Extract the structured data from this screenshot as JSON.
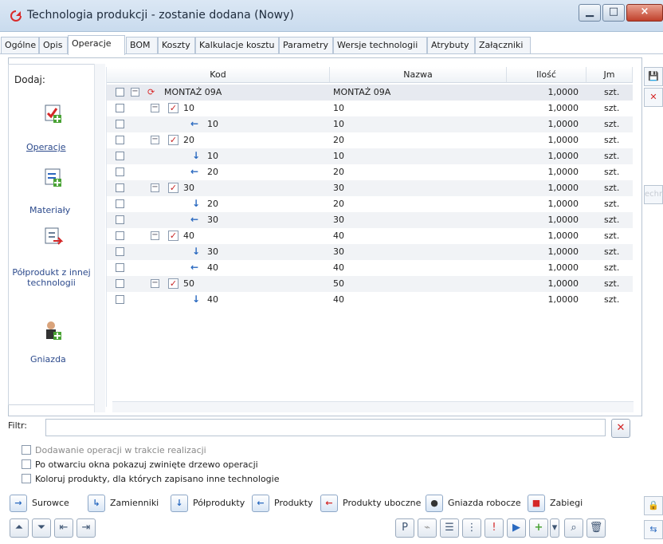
{
  "title": "Technologia produkcji - zostanie dodana  (Nowy)",
  "tabs": [
    "Ogólne",
    "Opis",
    "Operacje",
    "BOM",
    "Koszty",
    "Kalkulacje kosztu",
    "Parametry",
    "Wersje technologii",
    "Atrybuty",
    "Załączniki"
  ],
  "sidebar": {
    "dodaj": "Dodaj:",
    "operacje": "Operacje",
    "materialy": "Materiały",
    "polprodukt": "Półprodukt z innej technologii",
    "gniazda": "Gniazda"
  },
  "headers": [
    "Kod",
    "Nazwa",
    "Ilość",
    "Jm"
  ],
  "rows": [
    {
      "code": "MONTAŻ 09A",
      "name": "MONTAŻ 09A",
      "qty": "1,0000",
      "unit": "szt."
    },
    {
      "code": "10",
      "name": "10",
      "qty": "1,0000",
      "unit": "szt."
    },
    {
      "code": "10",
      "name": "10",
      "qty": "1,0000",
      "unit": "szt."
    },
    {
      "code": "20",
      "name": "20",
      "qty": "1,0000",
      "unit": "szt."
    },
    {
      "code": "10",
      "name": "10",
      "qty": "1,0000",
      "unit": "szt."
    },
    {
      "code": "20",
      "name": "20",
      "qty": "1,0000",
      "unit": "szt."
    },
    {
      "code": "30",
      "name": "30",
      "qty": "1,0000",
      "unit": "szt."
    },
    {
      "code": "20",
      "name": "20",
      "qty": "1,0000",
      "unit": "szt."
    },
    {
      "code": "30",
      "name": "30",
      "qty": "1,0000",
      "unit": "szt."
    },
    {
      "code": "40",
      "name": "40",
      "qty": "1,0000",
      "unit": "szt."
    },
    {
      "code": "30",
      "name": "30",
      "qty": "1,0000",
      "unit": "szt."
    },
    {
      "code": "40",
      "name": "40",
      "qty": "1,0000",
      "unit": "szt."
    },
    {
      "code": "50",
      "name": "50",
      "qty": "1,0000",
      "unit": "szt."
    },
    {
      "code": "40",
      "name": "40",
      "qty": "1,0000",
      "unit": "szt."
    }
  ],
  "filter": "Filtr:",
  "checks": [
    "Dodawanie operacji w trakcie realizacji",
    "Po otwarciu okna pokazuj zwinięte drzewo operacji",
    "Koloruj produkty, dla których zapisano inne technologie"
  ],
  "legend": [
    "Surowce",
    "Zamienniki",
    "Półprodukty",
    "Produkty",
    "Produkty uboczne",
    "Gniazda robocze",
    "Zabiegi"
  ],
  "side_text": "echn"
}
